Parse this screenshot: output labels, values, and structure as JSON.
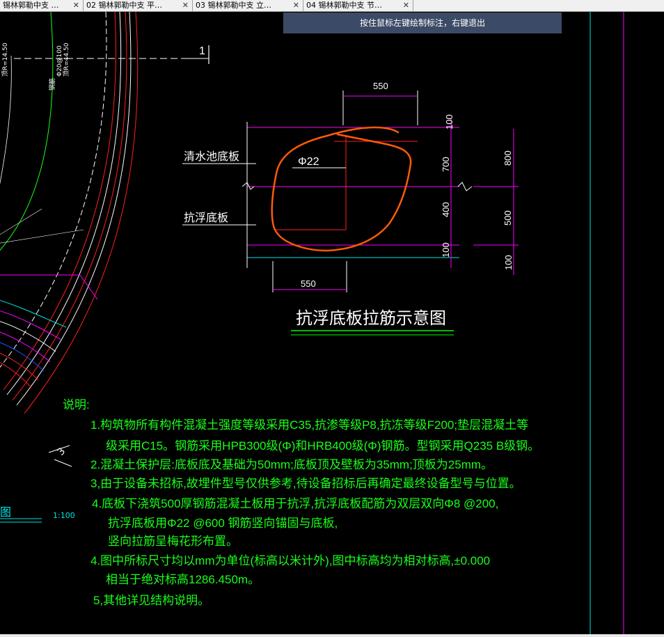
{
  "tabs": [
    {
      "label": "锡林郭勒中支 …",
      "close": "✕"
    },
    {
      "label": "02  锡林郭勒中支  平…",
      "close": "✕"
    },
    {
      "label": "03  锡林郭勒中支  立…",
      "close": "✕"
    },
    {
      "label": "04  锡林郭勒中支  节…",
      "close": "✕"
    }
  ],
  "hint_bar": "按住鼠标左键绘制标注，右键退出",
  "drawing": {
    "section_mark": "1",
    "section_mark_3": "3",
    "scale": "1:100",
    "left_fragment": "图",
    "left_vertical_1": "顶R=14.50",
    "left_vertical_2": "钢筋",
    "left_vertical_3": "Φ20@100",
    "left_vertical_4": "顶R=44.50",
    "labels": {
      "clearwater_slab": "清水池底板",
      "antifloat_slab": "抗浮底板",
      "rebar": "Φ22",
      "title": "抗浮底板拉筋示意图"
    },
    "dims": {
      "top_550": "550",
      "bottom_550": "550",
      "d100_top": "100",
      "d700": "700",
      "d400": "400",
      "d100_bottom": "100",
      "d800": "800",
      "d500": "500",
      "d100_right": "100"
    }
  },
  "notes": {
    "heading": "说明:",
    "lines": [
      "1.构筑物所有构件混凝土强度等级采用C35,抗渗等级P8,抗冻等级F200;垫层混凝土等",
      "级采用C15。钢筋采用HPB300级(Φ)和HRB400级(Φ)钢筋。型钢采用Q235 B级钢。",
      "2.混凝土保护层:底板底及基础为50mm;底板顶及壁板为35mm;顶板为25mm。",
      "3,由于设备未招标,故埋件型号仅供参考,待设备招标后再确定最终设备型号与位置。",
      "4.底板下浇筑500厚钢筋混凝土板用于抗浮,抗浮底板配筋为双层双向Φ8 @200,",
      "抗浮底板用Φ22 @600 钢筋竖向锚固与底板,",
      "竖向拉筋呈梅花形布置。",
      "4.图中所标尺寸均以mm为单位(标高以米计外),图中标高均为相对标高,±0.000",
      "相当于绝对标高1286.450m。",
      "5,其他详见结构说明。"
    ]
  },
  "colors": {
    "background": "#000000",
    "note_green": "#19ff19",
    "magenta": "#ff00ff",
    "cyan": "#00e5e5",
    "orange_markup": "#ff5a0a",
    "red": "#ff2020",
    "title_green": "#00ff00"
  }
}
